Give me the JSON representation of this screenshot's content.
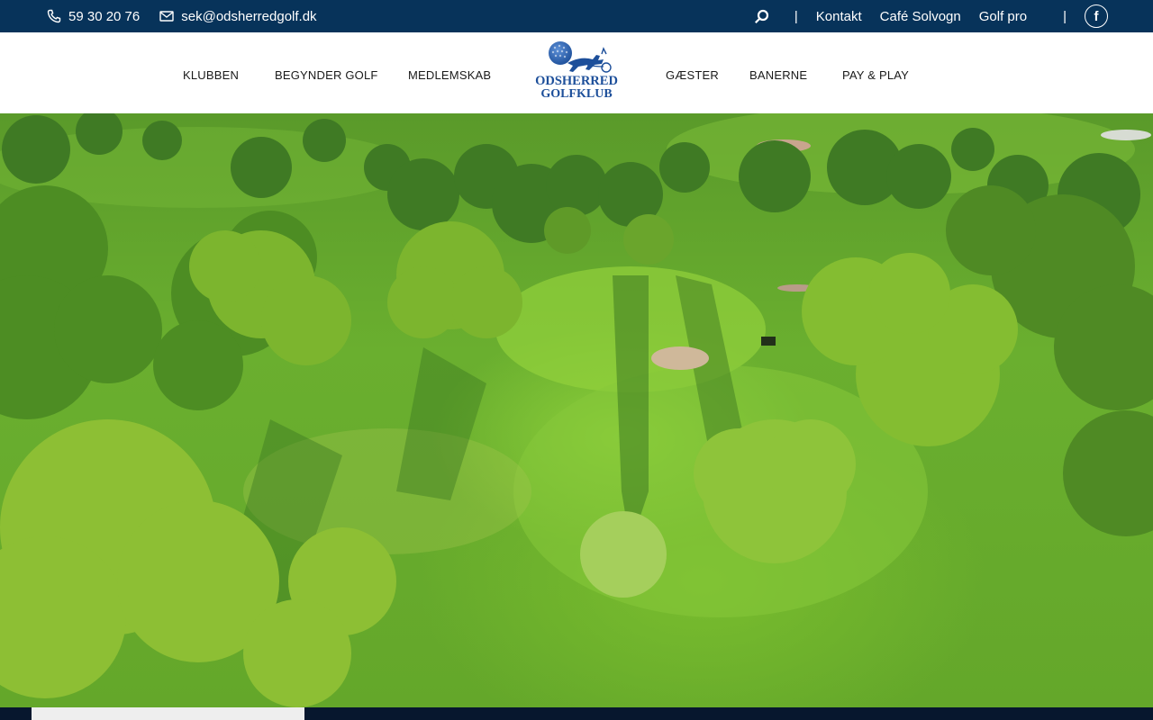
{
  "topbar": {
    "phone": "59 30 20 76",
    "email": "sek@odsherredgolf.dk",
    "separator": "|",
    "links": [
      {
        "label": "Kontakt"
      },
      {
        "label": "Café Solvogn"
      },
      {
        "label": "Golf pro"
      }
    ],
    "social_icon": "f",
    "icons": [
      "phone-icon",
      "mail-icon",
      "search-icon",
      "facebook-icon"
    ]
  },
  "nav": {
    "left": [
      {
        "label": "KLUBBEN"
      },
      {
        "label": "BEGYNDER GOLF"
      },
      {
        "label": "MEDLEMSKAB"
      }
    ],
    "right": [
      {
        "label": "GÆSTER"
      },
      {
        "label": "BANERNE"
      },
      {
        "label": "PAY & PLAY"
      }
    ]
  },
  "logo": {
    "line1": "ODSHERRED",
    "line2": "GOLFKLUB"
  },
  "colors": {
    "topbar_bg": "#07335a",
    "logo_blue": "#1d4f9a",
    "footer_dark": "#07172e"
  }
}
